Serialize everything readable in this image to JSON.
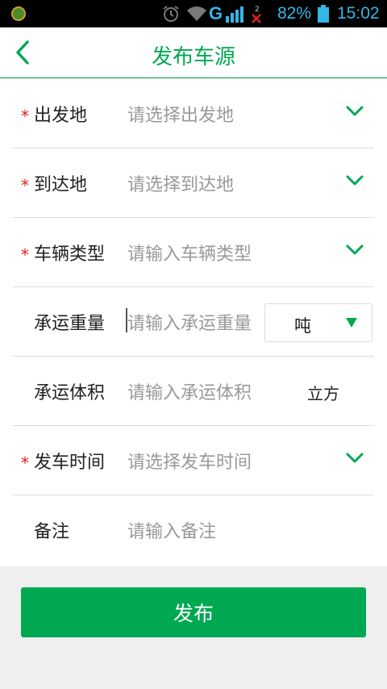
{
  "status_bar": {
    "network": "G",
    "sim_slot": "2",
    "battery_percent": "82%",
    "time": "15:02"
  },
  "header": {
    "title": "发布车源"
  },
  "form": {
    "rows": [
      {
        "label": "出发地",
        "placeholder": "请选择出发地",
        "required": true
      },
      {
        "label": "到达地",
        "placeholder": "请选择到达地",
        "required": true
      },
      {
        "label": "车辆类型",
        "placeholder": "请输入车辆类型",
        "required": true
      },
      {
        "label": "承运重量",
        "placeholder": "请输入承运重量",
        "required": false,
        "unit": "吨"
      },
      {
        "label": "承运体积",
        "placeholder": "请输入承运体积",
        "required": false,
        "unit": "立方"
      },
      {
        "label": "发车时间",
        "placeholder": "请选择发车时间",
        "required": true
      },
      {
        "label": "备注",
        "placeholder": "请输入备注",
        "required": false
      }
    ],
    "required_mark": "*"
  },
  "publish_button": {
    "label": "发布"
  },
  "colors": {
    "accent": "#00a851",
    "required": "#e02020",
    "placeholder": "#999999"
  }
}
